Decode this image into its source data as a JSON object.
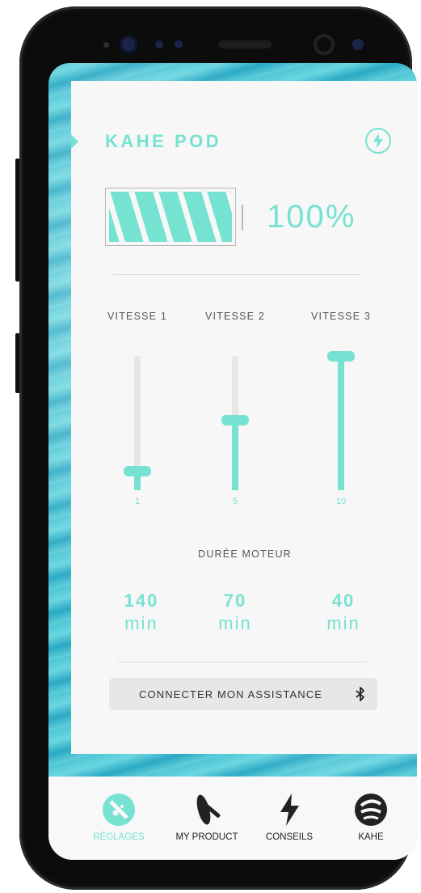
{
  "colors": {
    "accent": "#76e2d1",
    "card_bg": "#f7f7f7",
    "text_gray": "#555555",
    "tab_text": "#222222"
  },
  "header": {
    "title": "KAHE POD",
    "power_icon": "lightning-icon"
  },
  "battery": {
    "level_fraction": 1.0,
    "percent_text": "100%"
  },
  "speeds": [
    {
      "label": "VITESSE 1",
      "value": "1",
      "max": 10
    },
    {
      "label": "VITESSE 2",
      "value": "5",
      "max": 10
    },
    {
      "label": "VITESSE 3",
      "value": "10",
      "max": 10
    }
  ],
  "motor_duration": {
    "label": "DURÉE MOTEUR",
    "items": [
      {
        "number": "140",
        "unit": "min"
      },
      {
        "number": "70",
        "unit": "min"
      },
      {
        "number": "40",
        "unit": "min"
      }
    ]
  },
  "connect": {
    "label": "CONNECTER MON ASSISTANCE",
    "icon": "bluetooth-icon"
  },
  "tabs": [
    {
      "label": "RÉGLAGES",
      "icon": "gauge-icon",
      "active": true
    },
    {
      "label": "MY PRODUCT",
      "icon": "surfboard-icon",
      "active": false
    },
    {
      "label": "CONSEILS",
      "icon": "lightning-icon",
      "active": false
    },
    {
      "label": "KAHE",
      "icon": "kahe-logo-icon",
      "active": false
    }
  ]
}
